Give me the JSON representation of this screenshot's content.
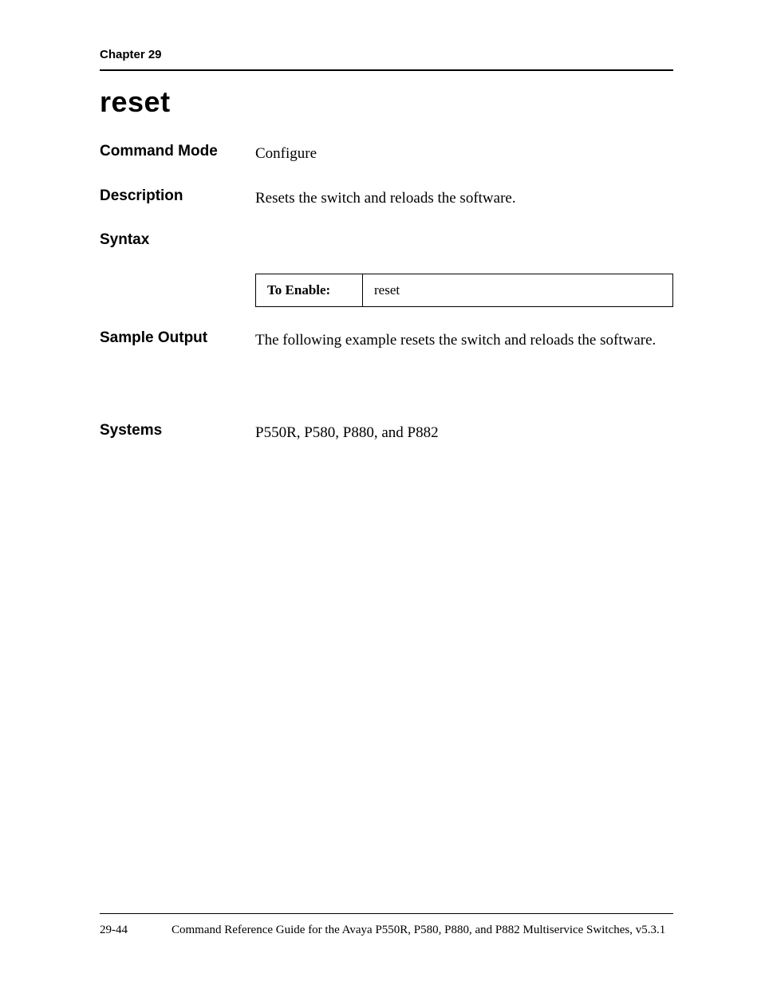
{
  "header": {
    "chapter": "Chapter 29"
  },
  "title": "reset",
  "sections": {
    "command_mode": {
      "label": "Command Mode",
      "value": "Configure"
    },
    "description": {
      "label": "Description",
      "value": "Resets the switch and reloads the software."
    },
    "syntax": {
      "label": "Syntax"
    },
    "sample_output": {
      "label": "Sample Output",
      "value": "The following example resets the switch and reloads the software."
    },
    "systems": {
      "label": "Systems",
      "value": "P550R, P580, P880, and P882"
    }
  },
  "syntax_table": {
    "header": "To Enable:",
    "value": "reset"
  },
  "footer": {
    "page_number": "29-44",
    "title": "Command Reference Guide for the Avaya P550R, P580, P880, and P882 Multiservice Switches, v5.3.1"
  }
}
